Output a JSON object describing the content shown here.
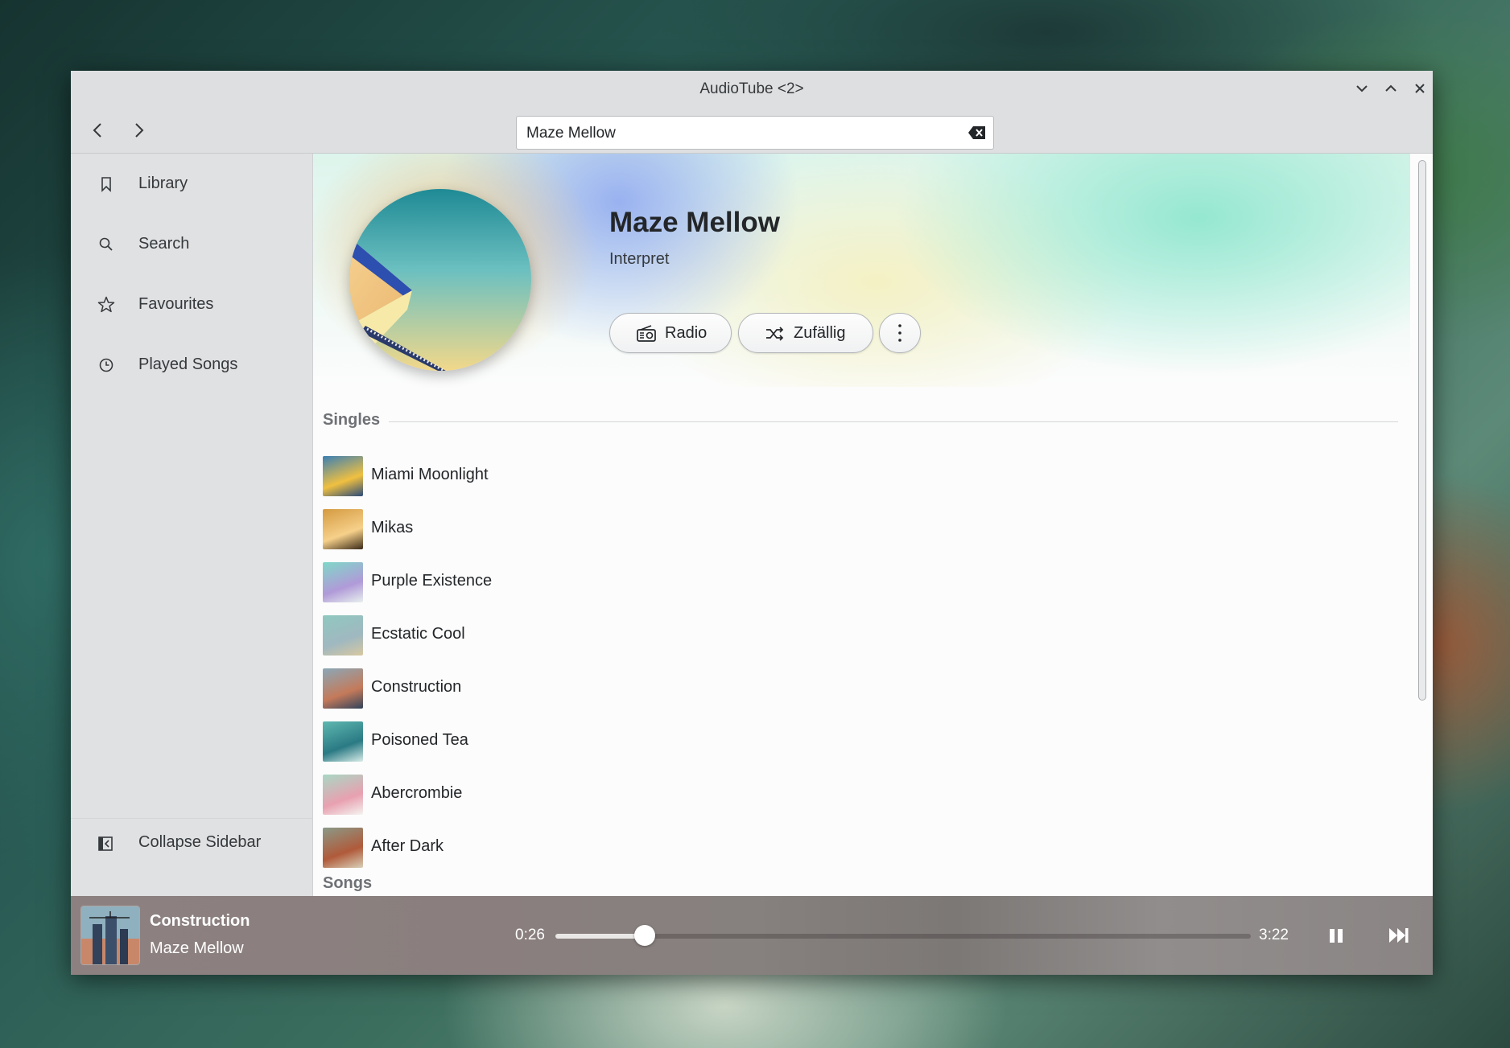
{
  "window": {
    "title": "AudioTube <2>",
    "controls": [
      "minimize",
      "maximize",
      "close"
    ]
  },
  "toolbar": {
    "back_icon": "chevron-left-icon",
    "forward_icon": "chevron-right-icon",
    "search_value": "Maze Mellow",
    "clear_icon": "backspace-clear-icon"
  },
  "sidebar": {
    "items": [
      {
        "label": "Library",
        "icon": "bookmark-icon"
      },
      {
        "label": "Search",
        "icon": "search-icon"
      },
      {
        "label": "Favourites",
        "icon": "star-icon"
      },
      {
        "label": "Played Songs",
        "icon": "clock-icon"
      }
    ],
    "collapse_label": "Collapse Sidebar"
  },
  "artist": {
    "name": "Maze Mellow",
    "subtitle": "Interpret",
    "radio_label": "Radio",
    "shuffle_label": "Zufällig",
    "more_icon": "more-vertical-icon"
  },
  "singles": {
    "heading": "Singles",
    "items": [
      {
        "title": "Miami Moonlight",
        "thumb_colors": [
          "#3a7fb5",
          "#f0c040",
          "#2a4a7a"
        ]
      },
      {
        "title": "Mikas",
        "thumb_colors": [
          "#d49a40",
          "#f6d08a",
          "#3a2a18"
        ]
      },
      {
        "title": "Purple Existence",
        "thumb_colors": [
          "#7fd8c8",
          "#b09ad8",
          "#e8f0ee"
        ]
      },
      {
        "title": "Ecstatic Cool",
        "thumb_colors": [
          "#8fc8c0",
          "#a0b8c0",
          "#d8c8a0"
        ]
      },
      {
        "title": "Construction",
        "thumb_colors": [
          "#8aa8b8",
          "#c47a5a",
          "#30425a"
        ]
      },
      {
        "title": "Poisoned Tea",
        "thumb_colors": [
          "#5fb8b0",
          "#2a7a84",
          "#d8ece8"
        ]
      },
      {
        "title": "Abercrombie",
        "thumb_colors": [
          "#a8d8c4",
          "#e8a0b0",
          "#f4f4f0"
        ]
      },
      {
        "title": "After Dark",
        "thumb_colors": [
          "#8a9a88",
          "#b05a3a",
          "#d8d0b8"
        ]
      }
    ]
  },
  "songs": {
    "heading": "Songs"
  },
  "player": {
    "title": "Construction",
    "artist": "Maze Mellow",
    "current_time": "0:26",
    "total_time": "3:22",
    "progress": 0.1287,
    "pause_icon": "pause-icon",
    "next_icon": "skip-next-icon"
  }
}
